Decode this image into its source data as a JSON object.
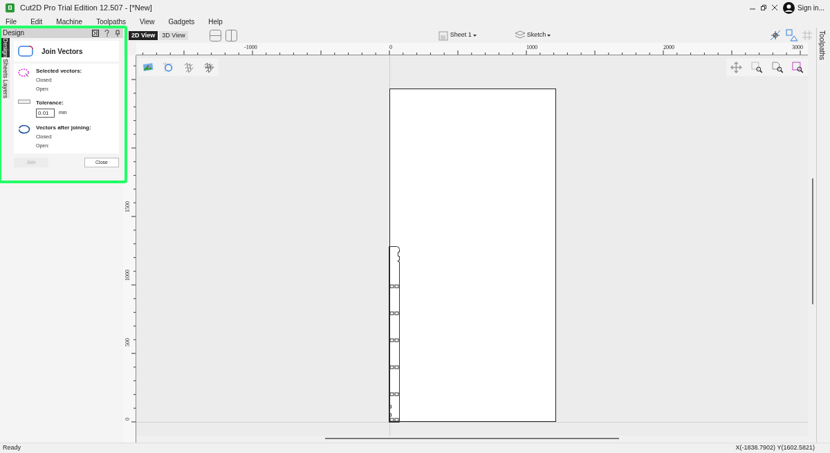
{
  "window": {
    "title": "Cut2D Pro Trial Edition 12.507 - [*New]",
    "sign_in": "Sign in..."
  },
  "menu": [
    "File",
    "Edit",
    "Machine",
    "Toolpaths",
    "View",
    "Gadgets",
    "Help"
  ],
  "panel": {
    "title": "Design",
    "tool_title": "Join Vectors",
    "side_tabs": [
      {
        "label": "Design",
        "selected": true
      },
      {
        "label": "Sheets",
        "selected": false
      },
      {
        "label": "Layers",
        "selected": false
      }
    ],
    "sections": [
      {
        "kind": "selected",
        "heading": "Selected vectors:",
        "lines": [
          "Closed:",
          "Open:"
        ]
      },
      {
        "kind": "tolerance",
        "heading": "Tolerance:",
        "value": "0.01",
        "unit": "mm"
      },
      {
        "kind": "result",
        "heading": "Vectors after joining:",
        "lines": [
          "Closed:",
          "Open:"
        ]
      }
    ],
    "buttons": [
      {
        "label": "Join",
        "disabled": true
      },
      {
        "label": "Close",
        "disabled": false
      }
    ]
  },
  "view_tabs": [
    {
      "label": "2D View",
      "selected": true
    },
    {
      "label": "3D View",
      "selected": false
    }
  ],
  "sheet_dropdown": "Sheet 1",
  "layer_dropdown": "Sketch",
  "ruler": {
    "horizontal": [
      "-1000",
      "0",
      "1000",
      "2000",
      "3000"
    ],
    "vertical": [
      "1500",
      "1000",
      "500",
      "0"
    ]
  },
  "right_tab": "Toolpaths",
  "status_bar": {
    "message": "Ready",
    "coordinates": "X(-1838.7902) Y(1602.5821)"
  }
}
